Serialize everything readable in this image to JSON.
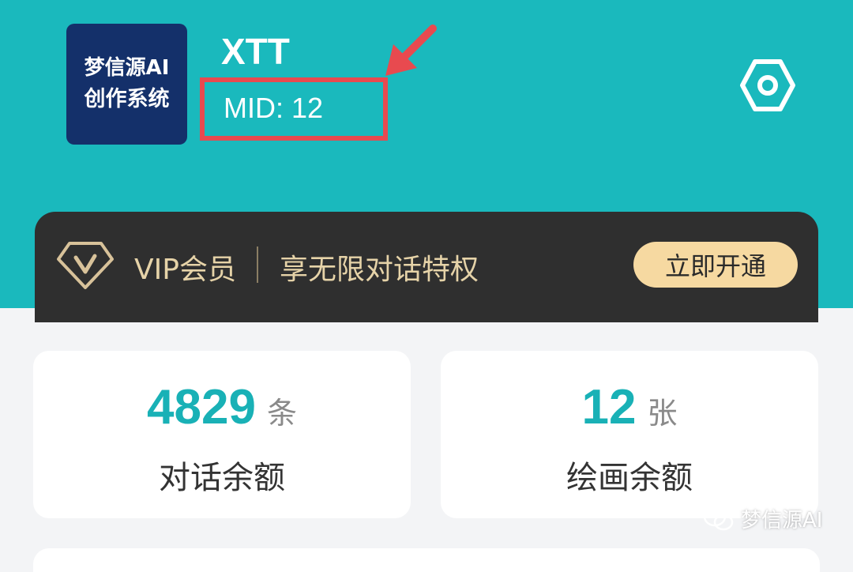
{
  "colors": {
    "header": "#1ab9bd",
    "logo_bg": "#14306a",
    "highlight": "#e84a4f",
    "vip_bg": "#2f2f2f",
    "vip_text": "#e6d3a8",
    "vip_button": "#f6d9a1",
    "stat_number": "#19b1b6"
  },
  "logo": {
    "line1": "梦信源AI",
    "line2": "创作系统"
  },
  "user": {
    "name": "XTT",
    "mid": "MID: 12"
  },
  "icons": {
    "settings": "settings-hexagon-icon",
    "vip": "vip-diamond-icon",
    "watermark": "wechat-icon"
  },
  "vip": {
    "label": "VIP会员",
    "desc": "享无限对话特权",
    "button": "立即开通"
  },
  "stats": [
    {
      "value": "4829",
      "unit": "条",
      "label": "对话余额"
    },
    {
      "value": "12",
      "unit": "张",
      "label": "绘画余额"
    }
  ],
  "watermark": "梦信源AI"
}
